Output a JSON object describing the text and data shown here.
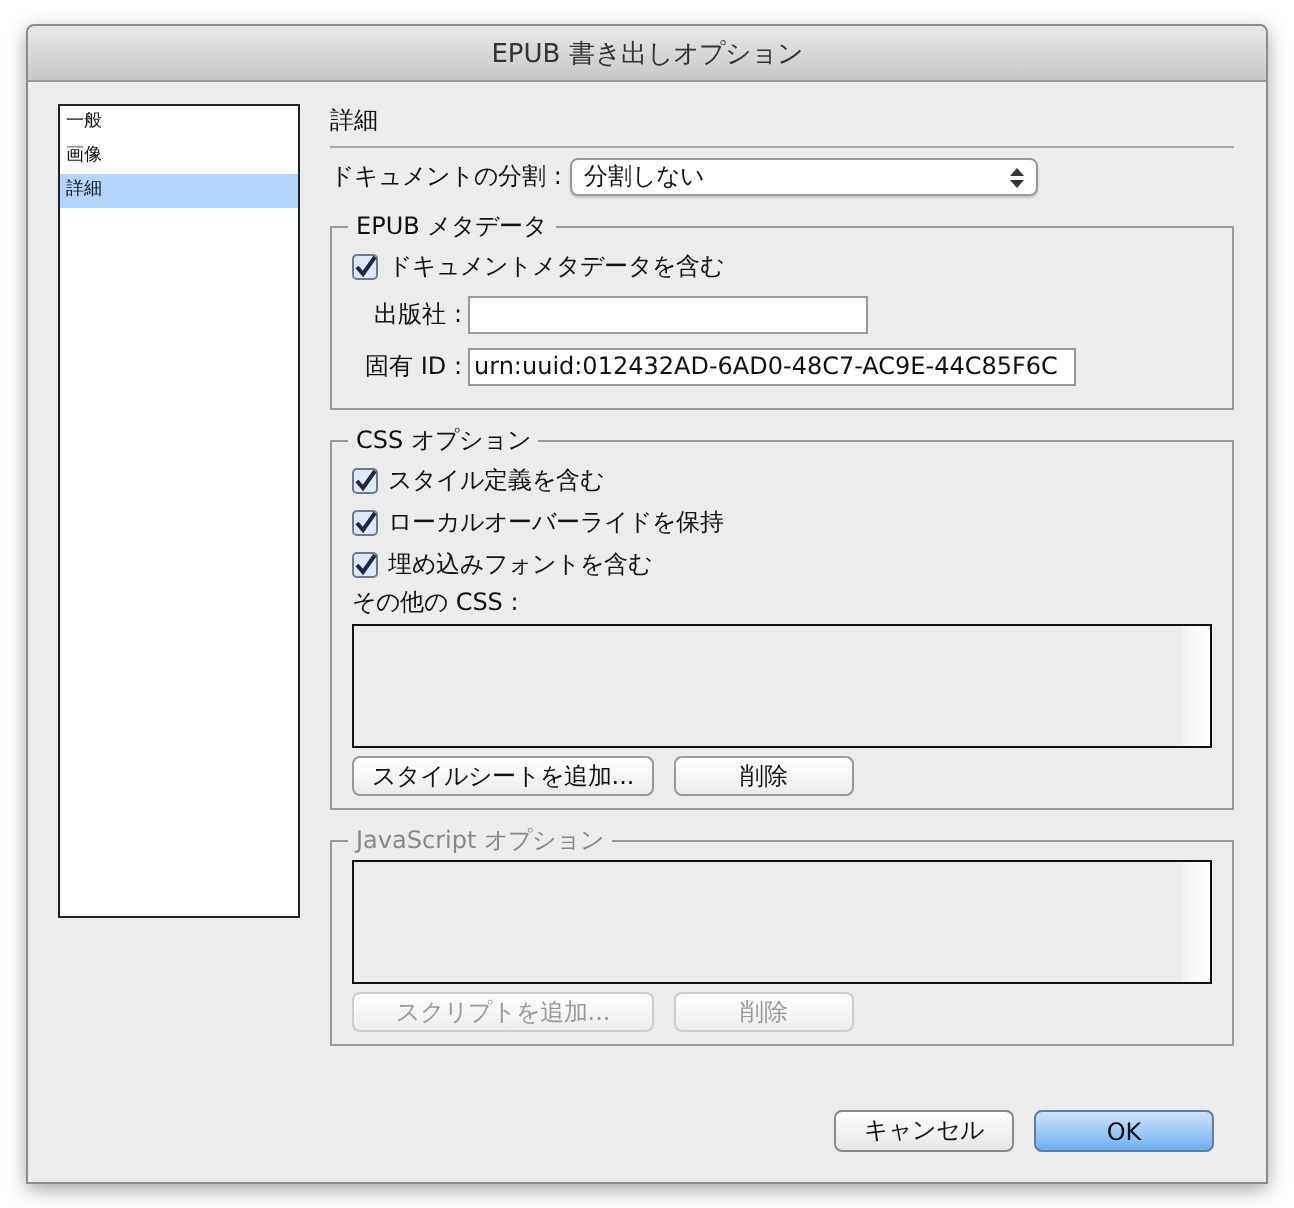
{
  "window": {
    "title": "EPUB 書き出しオプション"
  },
  "sidebar": {
    "items": [
      {
        "label": "一般",
        "selected": false
      },
      {
        "label": "画像",
        "selected": false
      },
      {
        "label": "詳細",
        "selected": true
      }
    ]
  },
  "section_title": "詳細",
  "split": {
    "label": "ドキュメントの分割 :",
    "value": "分割しない"
  },
  "groups": [
    {
      "kind": "metadata",
      "title": "EPUB メタデータ",
      "disabled": false,
      "checkboxes": [
        {
          "label": "ドキュメントメタデータを含む",
          "checked": true
        }
      ],
      "fields": [
        {
          "label": "出版社 :"
        },
        {
          "label": "固有 ID :",
          "value": "urn:uuid:012432AD-6AD0-48C7-AC9E-44C85F6C"
        }
      ]
    },
    {
      "kind": "list",
      "title": "CSS オプション",
      "disabled": false,
      "checkboxes": [
        {
          "label": "スタイル定義を含む",
          "checked": true
        },
        {
          "label": "ローカルオーバーライドを保持",
          "checked": true
        },
        {
          "label": "埋め込みフォントを含む",
          "checked": true
        }
      ],
      "list_label": "その他の CSS :",
      "buttons": [
        "スタイルシートを追加...",
        "削除"
      ]
    },
    {
      "kind": "list",
      "title": "JavaScript オプション",
      "disabled": true,
      "buttons": [
        "スクリプトを追加...",
        "削除"
      ]
    }
  ],
  "footer_buttons": [
    {
      "label": "キャンセル",
      "default": false
    },
    {
      "label": "OK",
      "default": true
    }
  ]
}
